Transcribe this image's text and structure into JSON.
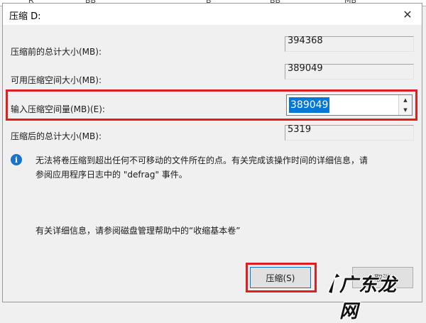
{
  "underlay": {
    "fragments": [
      "R",
      "BB",
      "B",
      "BB",
      "MB"
    ]
  },
  "dialog": {
    "title": "压缩 D:",
    "close_glyph": "✕"
  },
  "fields": [
    {
      "label": "压缩前的总计大小(MB):",
      "value": "394368"
    },
    {
      "label": "可用压缩空间大小(MB):",
      "value": "389049"
    },
    {
      "label": "输入压缩空间量(MB)(E):",
      "value": "389049"
    },
    {
      "label": "压缩后的总计大小(MB):",
      "value": "5319"
    }
  ],
  "info": {
    "icon": "info-icon",
    "line1": "无法将卷压缩到超出任何不可移动的文件所在的点。有关完成该操作时间的详细信息，请",
    "line2": "参阅应用程序日志中的 \"defrag\" 事件。"
  },
  "help_text": "有关详细信息，请参阅磁盘管理帮助中的“收缩基本卷”",
  "buttons": {
    "compress": "压缩(S)",
    "cancel": "取消"
  },
  "watermark": {
    "text": "广东龙网"
  },
  "colors": {
    "highlight": "#e02020",
    "selection": "#0078d7",
    "info_icon": "#1a73c8"
  }
}
